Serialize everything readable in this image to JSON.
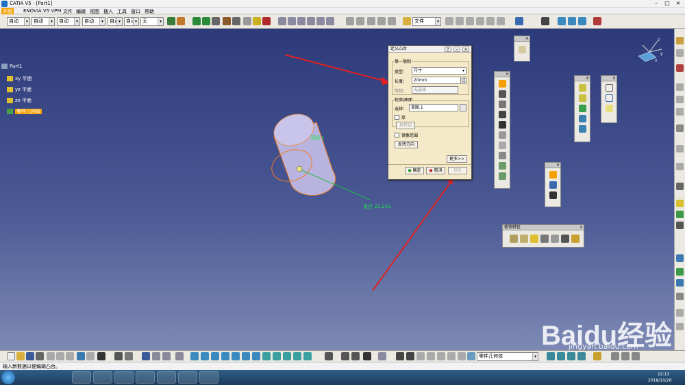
{
  "window": {
    "title": "CATIA V5 - [Part1]"
  },
  "menu": [
    {
      "label": "开始"
    },
    {
      "label": "ENOVIA V5 VPM"
    },
    {
      "label": "文件"
    },
    {
      "label": "编辑"
    },
    {
      "label": "视图"
    },
    {
      "label": "插入"
    },
    {
      "label": "工具"
    },
    {
      "label": "窗口"
    },
    {
      "label": "帮助"
    }
  ],
  "toolbar1": {
    "combos": [
      {
        "value": "自动"
      },
      {
        "value": "自动"
      },
      {
        "value": "自动"
      },
      {
        "value": "自动"
      },
      {
        "value": "自动"
      },
      {
        "value": "自动"
      },
      {
        "value": "无"
      }
    ],
    "file_combo": "文件"
  },
  "tree": {
    "root": "Part1",
    "planes": [
      {
        "label": "xy 平面"
      },
      {
        "label": "yz 平面"
      },
      {
        "label": "zx 平面"
      }
    ],
    "body": "零件几何体"
  },
  "model": {
    "face_label": "草图.1",
    "dimension_label": "直径 23.243"
  },
  "dialog": {
    "title": "定义凸台",
    "limit_group": "第一限制",
    "type_label": "类型：",
    "type_value": "尺寸",
    "length_label": "长度：",
    "length_value": "20mm",
    "limit_label": "限制：",
    "limit_value": "无选择",
    "profile_group": "轮廓/曲面",
    "selection_label": "选择：",
    "selection_value": "草图.1",
    "thick_label": "厚",
    "reverse_side": "反转边",
    "mirror_label": "镜像范围",
    "reverse_dir": "反转方向",
    "more": "更多>>",
    "ok": "确定",
    "cancel": "取消",
    "preview": "预览"
  },
  "feature_toolbar": {
    "title": "修饰特征"
  },
  "bottom": {
    "body_combo": "零件几何体"
  },
  "status": {
    "text": "输入新数据以便编辑凸台。"
  },
  "taskbar": {
    "time": "22:13",
    "date": "2018/10/26"
  },
  "watermark": {
    "brand": "Baidu经验",
    "url": "jingyan.baidu.com"
  },
  "colors": {
    "viewport_top": "#2c3a7a",
    "accent": "#f5a000",
    "arrow": "#e02020"
  }
}
